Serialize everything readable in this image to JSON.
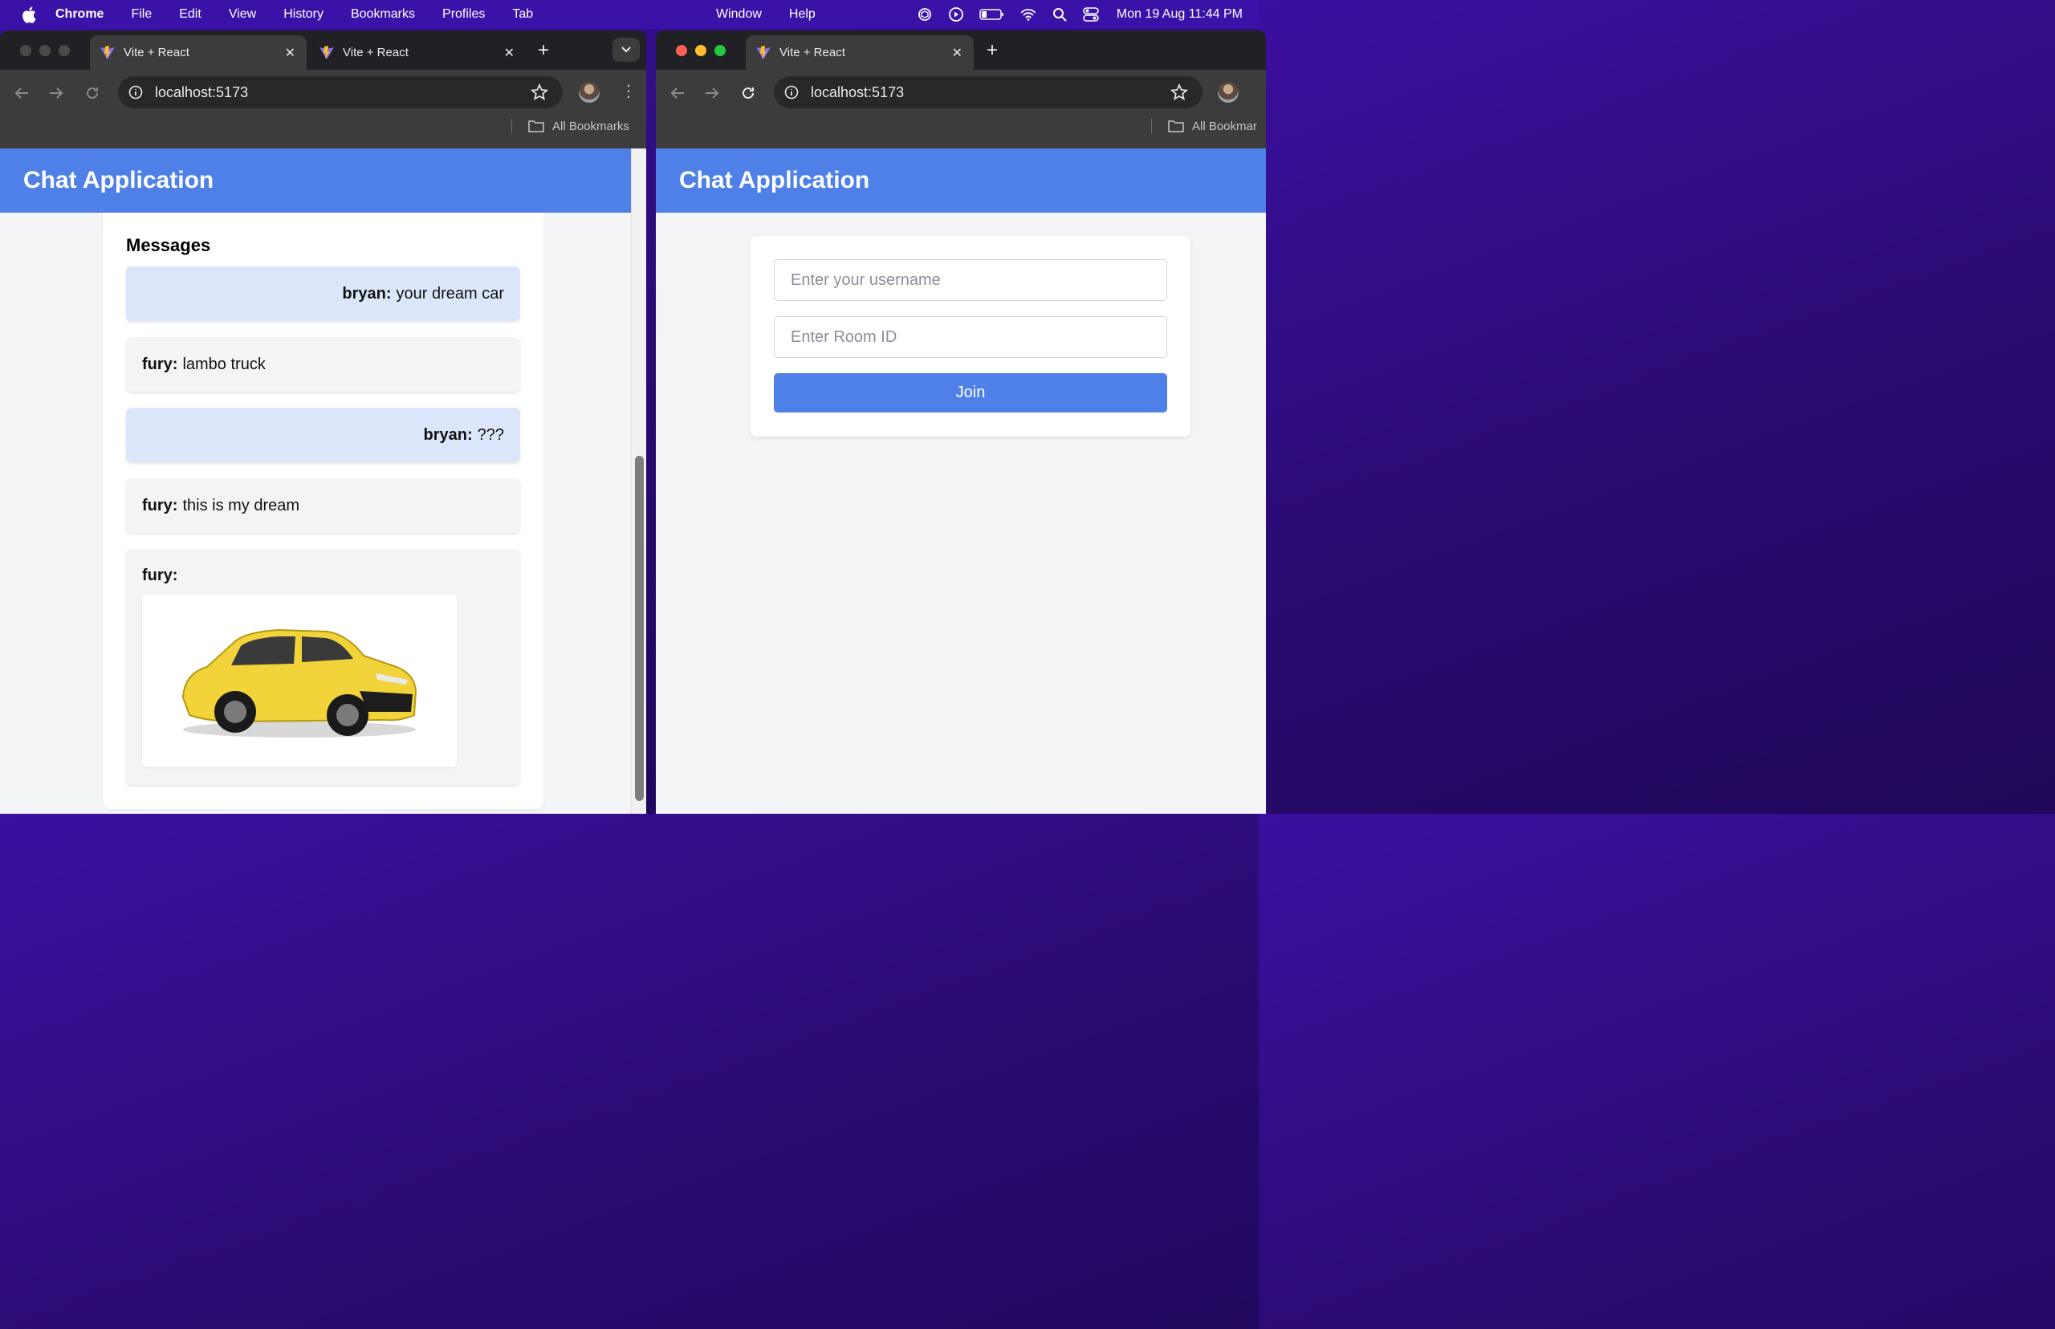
{
  "menubar": {
    "app_name": "Chrome",
    "menus": [
      "File",
      "Edit",
      "View",
      "History",
      "Bookmarks",
      "Profiles",
      "Tab"
    ],
    "menus_right": [
      "Window",
      "Help"
    ],
    "clock": "Mon 19 Aug  11:44 PM",
    "status_icons": [
      "chatgpt-icon",
      "play-circle-icon",
      "battery-icon",
      "wifi-icon",
      "spotlight-search-icon",
      "control-center-icon"
    ]
  },
  "left_window": {
    "tabs": [
      {
        "title": "Vite + React",
        "active": true
      },
      {
        "title": "Vite + React",
        "active": false
      }
    ],
    "url": "localhost:5173",
    "bookmarks_label": "All Bookmarks",
    "app_title": "Chat Application",
    "messages_heading": "Messages",
    "messages": [
      {
        "author": "bryan:",
        "text": "your dream car",
        "mine": true
      },
      {
        "author": "fury:",
        "text": "lambo truck",
        "mine": false
      },
      {
        "author": "bryan:",
        "text": "???",
        "mine": true
      },
      {
        "author": "fury:",
        "text": "this is my dream",
        "mine": false
      },
      {
        "author": "fury:",
        "text": "",
        "mine": false,
        "attachment": "yellow-suv-image"
      }
    ]
  },
  "right_window": {
    "tabs": [
      {
        "title": "Vite + React",
        "active": true
      }
    ],
    "url": "localhost:5173",
    "bookmarks_label": "All Bookmar",
    "app_title": "Chat Application",
    "login": {
      "username_placeholder": "Enter your username",
      "username_value": "",
      "room_placeholder": "Enter Room ID",
      "room_value": "",
      "join_label": "Join"
    }
  },
  "colors": {
    "header_blue": "#4f80e8",
    "mine_bubble": "#dbe6fb",
    "theirs_bubble": "#f3f4f6",
    "menubar": "#3a12a8"
  }
}
